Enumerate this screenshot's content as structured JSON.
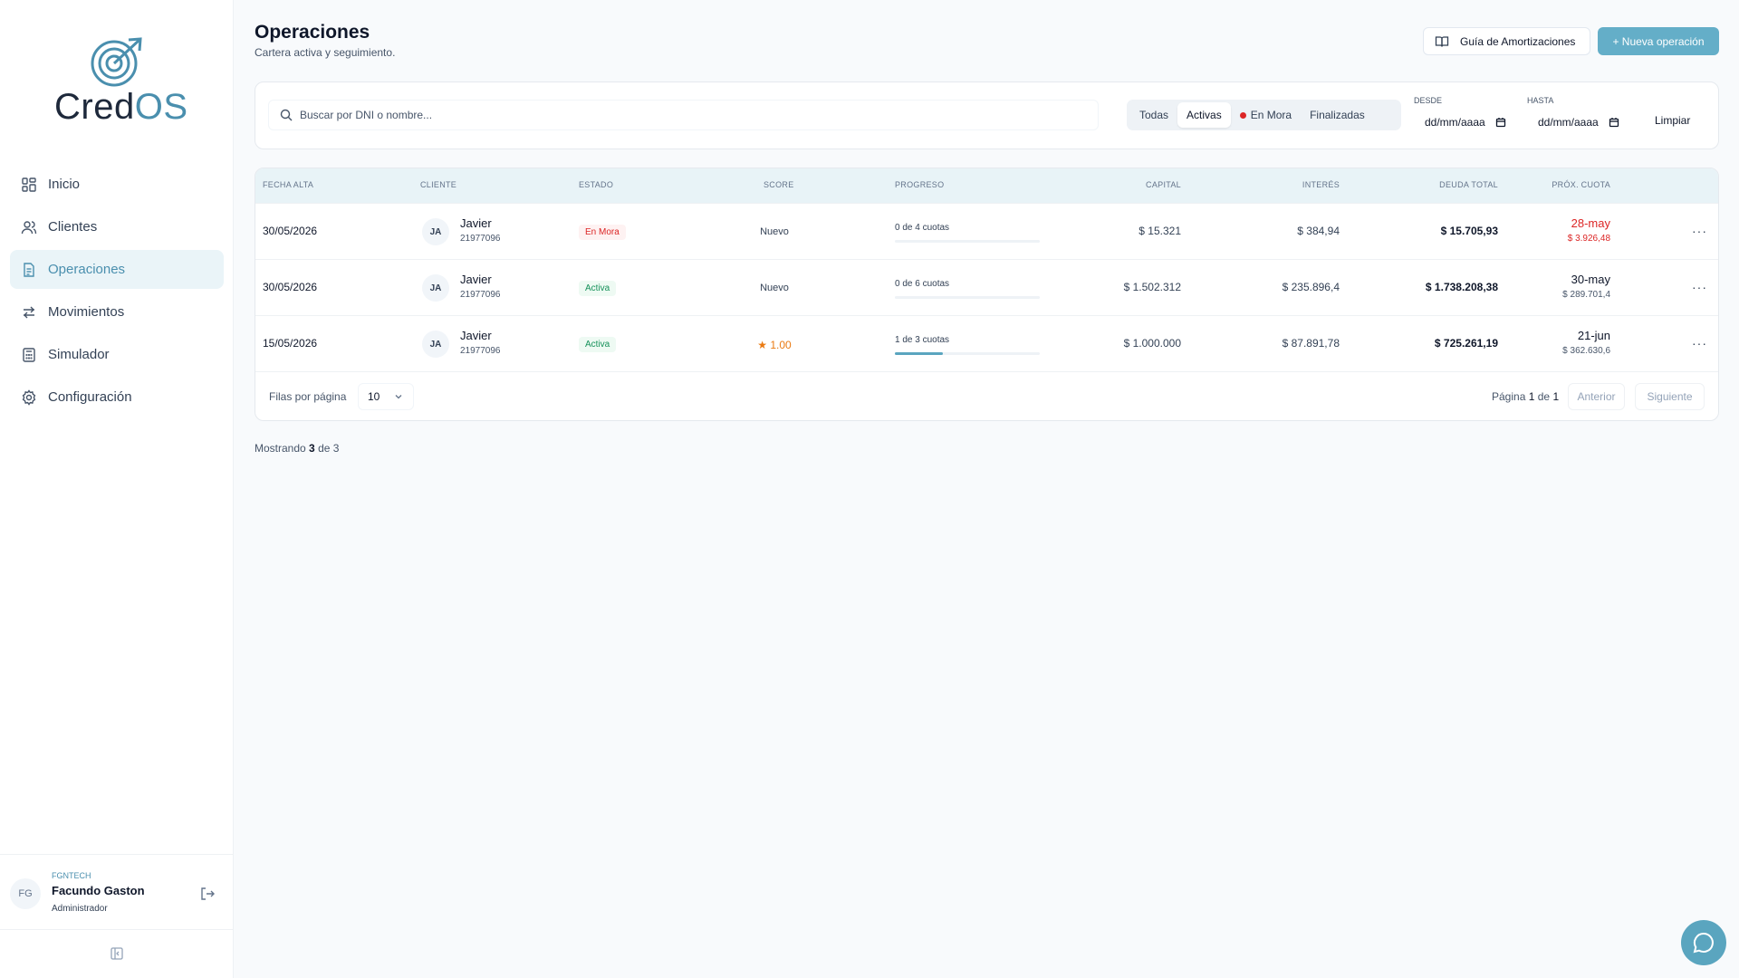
{
  "brand": {
    "name_part1": "Cred",
    "name_part2": "OS"
  },
  "nav": [
    {
      "label": "Inicio",
      "icon": "dashboard-icon"
    },
    {
      "label": "Clientes",
      "icon": "users-icon"
    },
    {
      "label": "Operaciones",
      "icon": "document-icon",
      "active": true
    },
    {
      "label": "Movimientos",
      "icon": "arrows-icon"
    },
    {
      "label": "Simulador",
      "icon": "calculator-icon"
    },
    {
      "label": "Configuración",
      "icon": "gear-icon"
    }
  ],
  "user": {
    "initials": "FG",
    "org": "FGNTECH",
    "name": "Facundo Gaston",
    "role": "Administrador"
  },
  "header": {
    "title": "Operaciones",
    "subtitle": "Cartera activa y seguimiento.",
    "guide_button": "Guía de Amortizaciones",
    "new_button": "+ Nueva operación"
  },
  "filters": {
    "search_placeholder": "Buscar por DNI o nombre...",
    "tabs": [
      "Todas",
      "Activas",
      "En Mora",
      "Finalizadas"
    ],
    "active_tab": "Activas",
    "desde_label": "DESDE",
    "hasta_label": "HASTA",
    "desde_value": "dd/mm/aaaa",
    "hasta_value": "dd/mm/aaaa",
    "clear_button": "Limpiar"
  },
  "table": {
    "columns": [
      "FECHA ALTA",
      "CLIENTE",
      "ESTADO",
      "SCORE",
      "PROGRESO",
      "CAPITAL",
      "INTERÉS",
      "DEUDA TOTAL",
      "PRÓX. CUOTA"
    ],
    "rows": [
      {
        "fecha": "30/05/2026",
        "initials": "JA",
        "cliente": "Javier",
        "dni": "21977096",
        "estado": "En Mora",
        "score": "Nuevo",
        "progreso": "0 de 4 cuotas",
        "progress_fraction": 0,
        "capital": "$ 15.321",
        "interes": "$ 384,94",
        "deuda": "$ 15.705,93",
        "prox_fecha": "28-may",
        "prox_monto": "$ 3.926,48"
      },
      {
        "fecha": "30/05/2026",
        "initials": "JA",
        "cliente": "Javier",
        "dni": "21977096",
        "estado": "Activa",
        "score": "Nuevo",
        "progreso": "0 de 6 cuotas",
        "progress_fraction": 0,
        "capital": "$ 1.502.312",
        "interes": "$ 235.896,4",
        "deuda": "$ 1.738.208,38",
        "prox_fecha": "30-may",
        "prox_monto": "$ 289.701,4"
      },
      {
        "fecha": "15/05/2026",
        "initials": "JA",
        "cliente": "Javier",
        "dni": "21977096",
        "estado": "Activa",
        "score": "1.00",
        "progreso": "1 de 3 cuotas",
        "progress_fraction": 0.333,
        "capital": "$ 1.000.000",
        "interes": "$ 87.891,78",
        "deuda": "$ 725.261,19",
        "prox_fecha": "21-jun",
        "prox_monto": "$ 362.630,6"
      }
    ]
  },
  "pagination": {
    "rows_label": "Filas por página",
    "rows_value": "10",
    "page_prefix": "Página",
    "page_current": "1",
    "page_of": "de",
    "page_total": "1",
    "prev": "Anterior",
    "next": "Siguiente"
  },
  "summary": {
    "prefix": "Mostrando",
    "shown": "3",
    "of": "de",
    "total": "3"
  },
  "colors": {
    "accent": "#64aec8",
    "danger": "#dc2626",
    "success": "#16915a",
    "star": "#ea7a12"
  }
}
